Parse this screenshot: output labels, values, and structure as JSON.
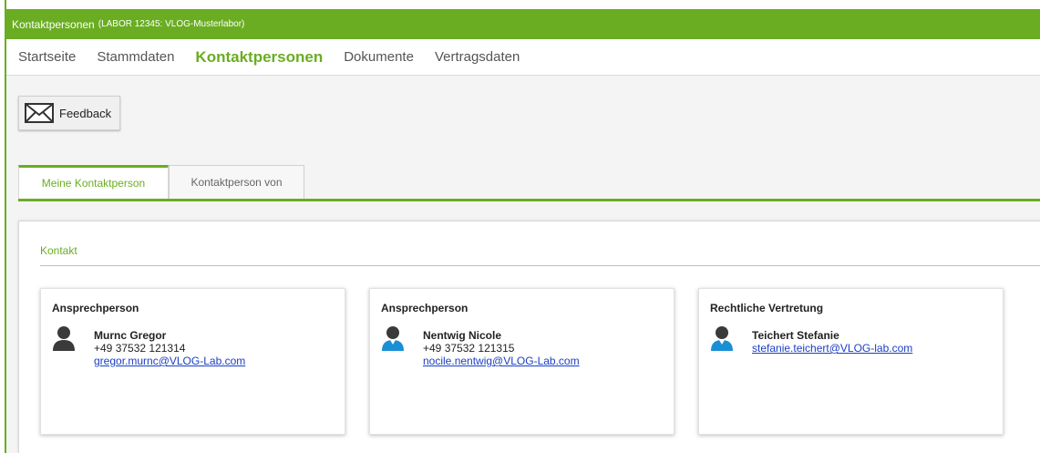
{
  "window": {
    "title": "Kontaktpersonen",
    "subtitle": "(LABOR 12345: VLOG-Musterlabor)"
  },
  "nav": {
    "items": [
      {
        "label": "Startseite"
      },
      {
        "label": "Stammdaten"
      },
      {
        "label": "Kontaktpersonen"
      },
      {
        "label": "Dokumente"
      },
      {
        "label": "Vertragsdaten"
      }
    ],
    "active_index": 2
  },
  "toolbar": {
    "feedback_label": "Feedback"
  },
  "tabs": [
    {
      "label": "Meine Kontaktperson"
    },
    {
      "label": "Kontaktperson von"
    }
  ],
  "section": {
    "title": "Kontakt"
  },
  "cards": [
    {
      "title": "Ansprechperson",
      "name": "Murnc Gregor",
      "phone": "+49 37532 121314",
      "email": "gregor.murnc@VLOG-Lab.com",
      "avatar_icon": "person-dark-icon"
    },
    {
      "title": "Ansprechperson",
      "name": "Nentwig Nicole",
      "phone": "+49 37532 121315",
      "email": "nocile.nentwig@VLOG-Lab.com",
      "avatar_icon": "person-blue-icon"
    },
    {
      "title": "Rechtliche Vertretung",
      "name": "Teichert Stefanie",
      "email": "stefanie.teichert@VLOG-lab.com",
      "avatar_icon": "person-blue-icon"
    }
  ],
  "colors": {
    "brand_green": "#6aad22",
    "link_blue": "#1a3fc4",
    "avatar_dark": "#3a3a3a",
    "avatar_blue": "#1a8fd6"
  }
}
